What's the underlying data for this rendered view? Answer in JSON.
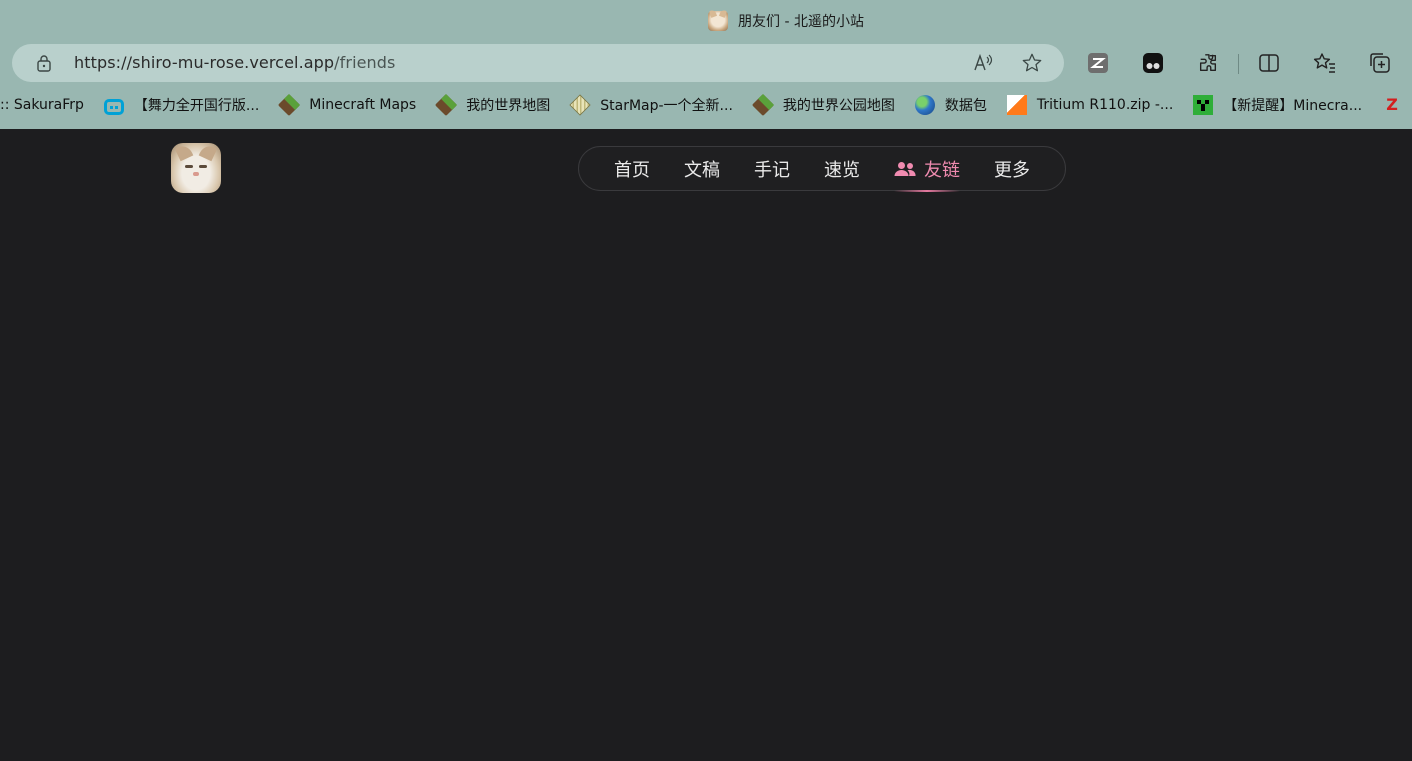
{
  "browser": {
    "tab_title": "朋友们 - 北遥的小站",
    "url_host": "https://shiro-mu-rose.vercel.app",
    "url_path": "/friends",
    "toolbar_icons": [
      "read-aloud-icon",
      "favorite-star-icon",
      "zotero-extension-icon",
      "tampermonkey-extension-icon",
      "extensions-icon",
      "split-screen-icon",
      "favorites-icon",
      "collections-icon"
    ]
  },
  "bookmarks": [
    {
      "label": ":: SakuraFrp",
      "icon": "none"
    },
    {
      "label": "【舞力全开国行版...",
      "icon": "bilibili-icon"
    },
    {
      "label": "Minecraft Maps",
      "icon": "grass-block-icon"
    },
    {
      "label": "我的世界地图",
      "icon": "grass-block-icon"
    },
    {
      "label": "StarMap-一个全新...",
      "icon": "map-icon"
    },
    {
      "label": "我的世界公园地图",
      "icon": "grass-block-icon"
    },
    {
      "label": "数据包",
      "icon": "globe-icon"
    },
    {
      "label": "Tritium R110.zip -...",
      "icon": "tritium-icon"
    },
    {
      "label": "【新提醒】Minecra...",
      "icon": "creeper-icon"
    }
  ],
  "site": {
    "nav": [
      {
        "label": "首页",
        "active": false
      },
      {
        "label": "文稿",
        "active": false
      },
      {
        "label": "手记",
        "active": false
      },
      {
        "label": "速览",
        "active": false
      },
      {
        "label": "友链",
        "active": true
      },
      {
        "label": "更多",
        "active": false
      }
    ]
  },
  "colors": {
    "chrome_bg": "#99b7b1",
    "page_bg": "#1d1d1f",
    "accent": "#f08bb0"
  }
}
